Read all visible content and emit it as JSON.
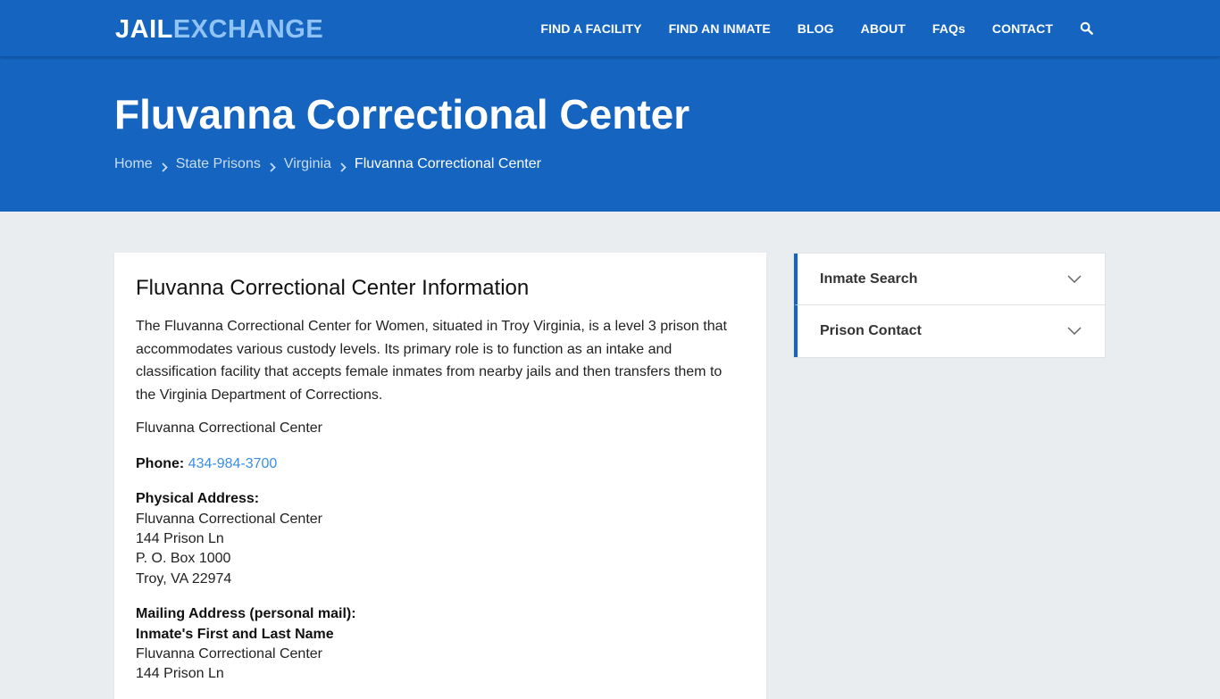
{
  "header": {
    "logo_part1": "JAIL",
    "logo_part2": "EXCHANGE",
    "nav": [
      {
        "label": "FIND A FACILITY"
      },
      {
        "label": "FIND AN INMATE"
      },
      {
        "label": "BLOG"
      },
      {
        "label": "ABOUT"
      },
      {
        "label": "FAQs"
      },
      {
        "label": "CONTACT"
      }
    ],
    "search_icon": "search-icon"
  },
  "hero": {
    "title": "Fluvanna Correctional Center",
    "breadcrumbs": [
      {
        "label": "Home"
      },
      {
        "label": "State Prisons"
      },
      {
        "label": "Virginia"
      }
    ],
    "current": "Fluvanna Correctional Center"
  },
  "main": {
    "heading": "Fluvanna Correctional Center Information",
    "intro": "The Fluvanna Correctional Center for Women, situated in Troy Virginia, is a level 3 prison that accommodates various custody levels. Its primary role is to function as an intake and classification facility that accepts female inmates from nearby jails and then transfers them to the Virginia Department of Corrections.",
    "facility_name": "Fluvanna Correctional Center",
    "phone_label": "Phone:",
    "phone": "434-984-3700",
    "physical_label": "Physical Address:",
    "physical": [
      "Fluvanna Correctional Center",
      "144 Prison Ln",
      "P. O. Box 1000",
      "Troy, VA 22974"
    ],
    "mailing_label": "Mailing Address (personal mail):",
    "mailing_name": "Inmate's First and Last Name",
    "mailing": [
      "Fluvanna Correctional Center",
      "144 Prison Ln"
    ]
  },
  "sidebar": {
    "items": [
      {
        "label": "Inmate Search"
      },
      {
        "label": "Prison Contact"
      }
    ]
  }
}
